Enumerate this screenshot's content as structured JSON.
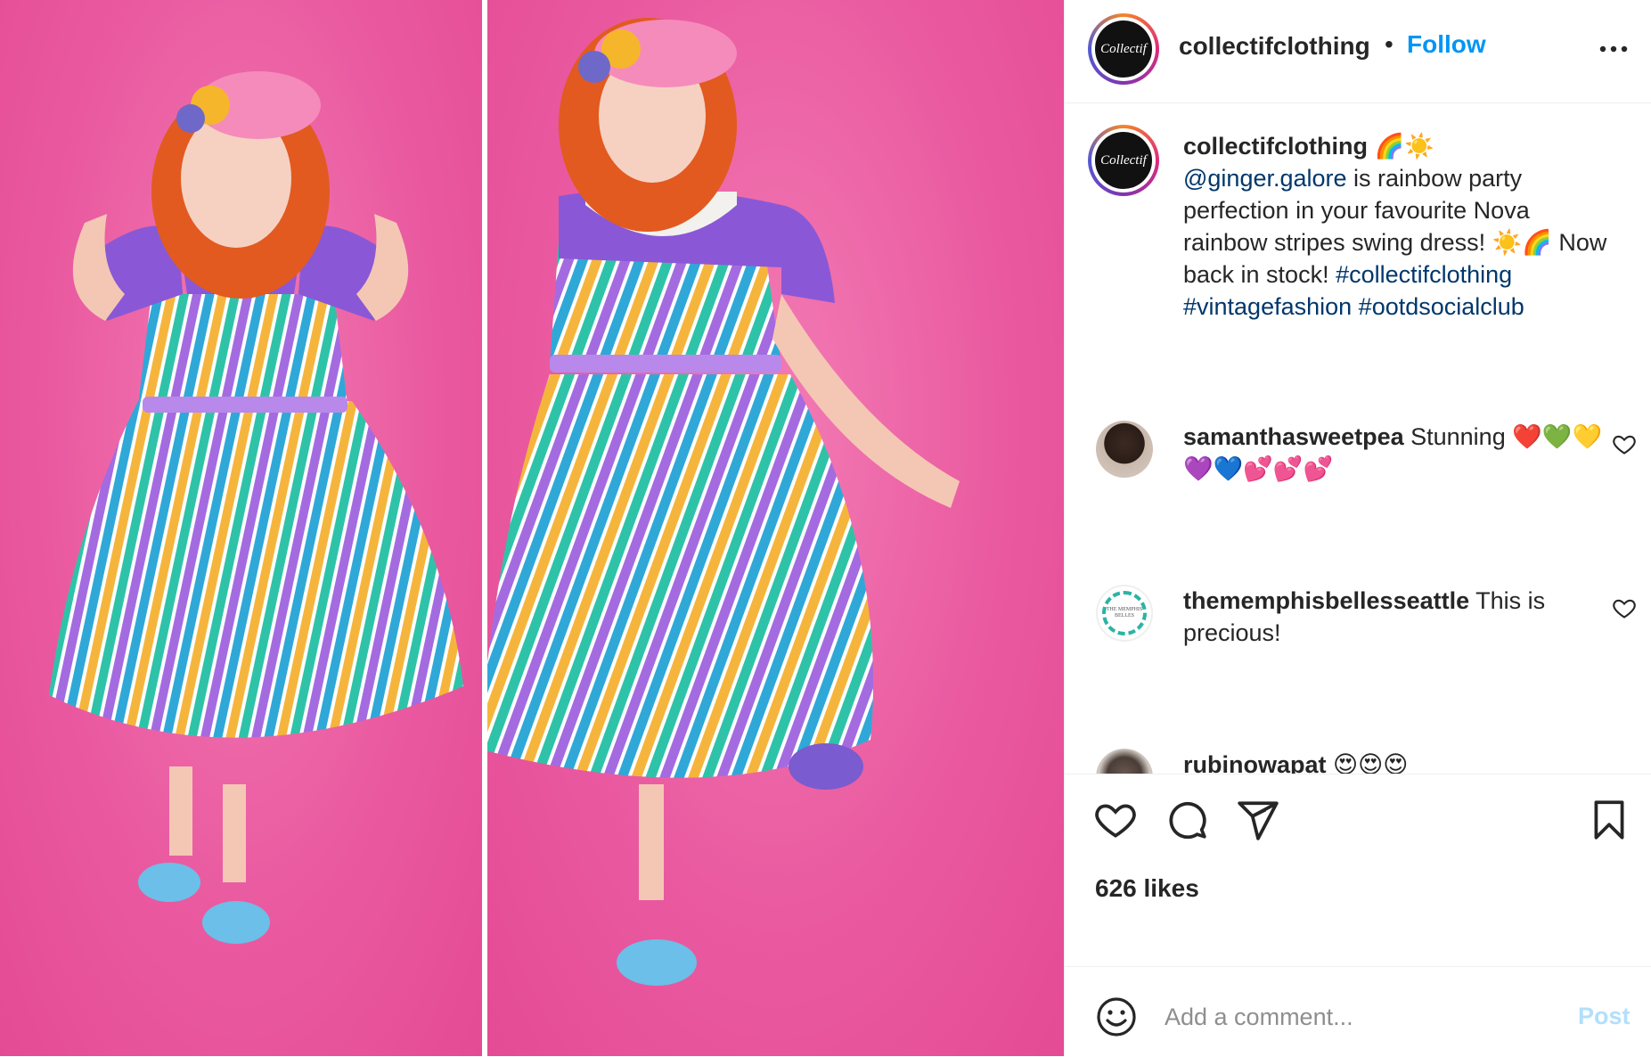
{
  "post": {
    "username": "collectifclothing",
    "separator": "•",
    "follow_label": "Follow",
    "more_icon": "more-horizontal-icon",
    "avatar_logo_text": "Collectif"
  },
  "caption": {
    "username": "collectifclothing",
    "emoji_after_name": "🌈☀️",
    "mention": "@ginger.galore",
    "text_1": " is rainbow party perfection in your favourite Nova rainbow stripes swing dress! ☀️🌈 Now back in stock! ",
    "hashtag_1": "#collectifclothing",
    "hashtag_2": "#vintagefashion",
    "hashtag_3": "#ootdsocialclub"
  },
  "comments": [
    {
      "username": "samanthasweetpea",
      "text": " Stunning ❤️💚💛💜💙💕💕💕"
    },
    {
      "username": "thememphisbellesseattle",
      "text": " This is precious!"
    },
    {
      "username": "rubinowapat",
      "text": " 😍😍😍"
    }
  ],
  "comment_avatar_text": "THE MEMPHIS BELLES",
  "actions": {
    "like_icon": "heart-icon",
    "comment_icon": "comment-icon",
    "share_icon": "share-icon",
    "save_icon": "bookmark-icon"
  },
  "likes": "626 likes",
  "add_comment": {
    "placeholder": "Add a comment...",
    "post_label": "Post",
    "emoji_icon": "smiley-icon"
  },
  "colors": {
    "background_pink": "#ea5aa0",
    "follow_blue": "#0095f6",
    "link_blue": "#00376b",
    "post_disabled": "#b2dffc"
  }
}
